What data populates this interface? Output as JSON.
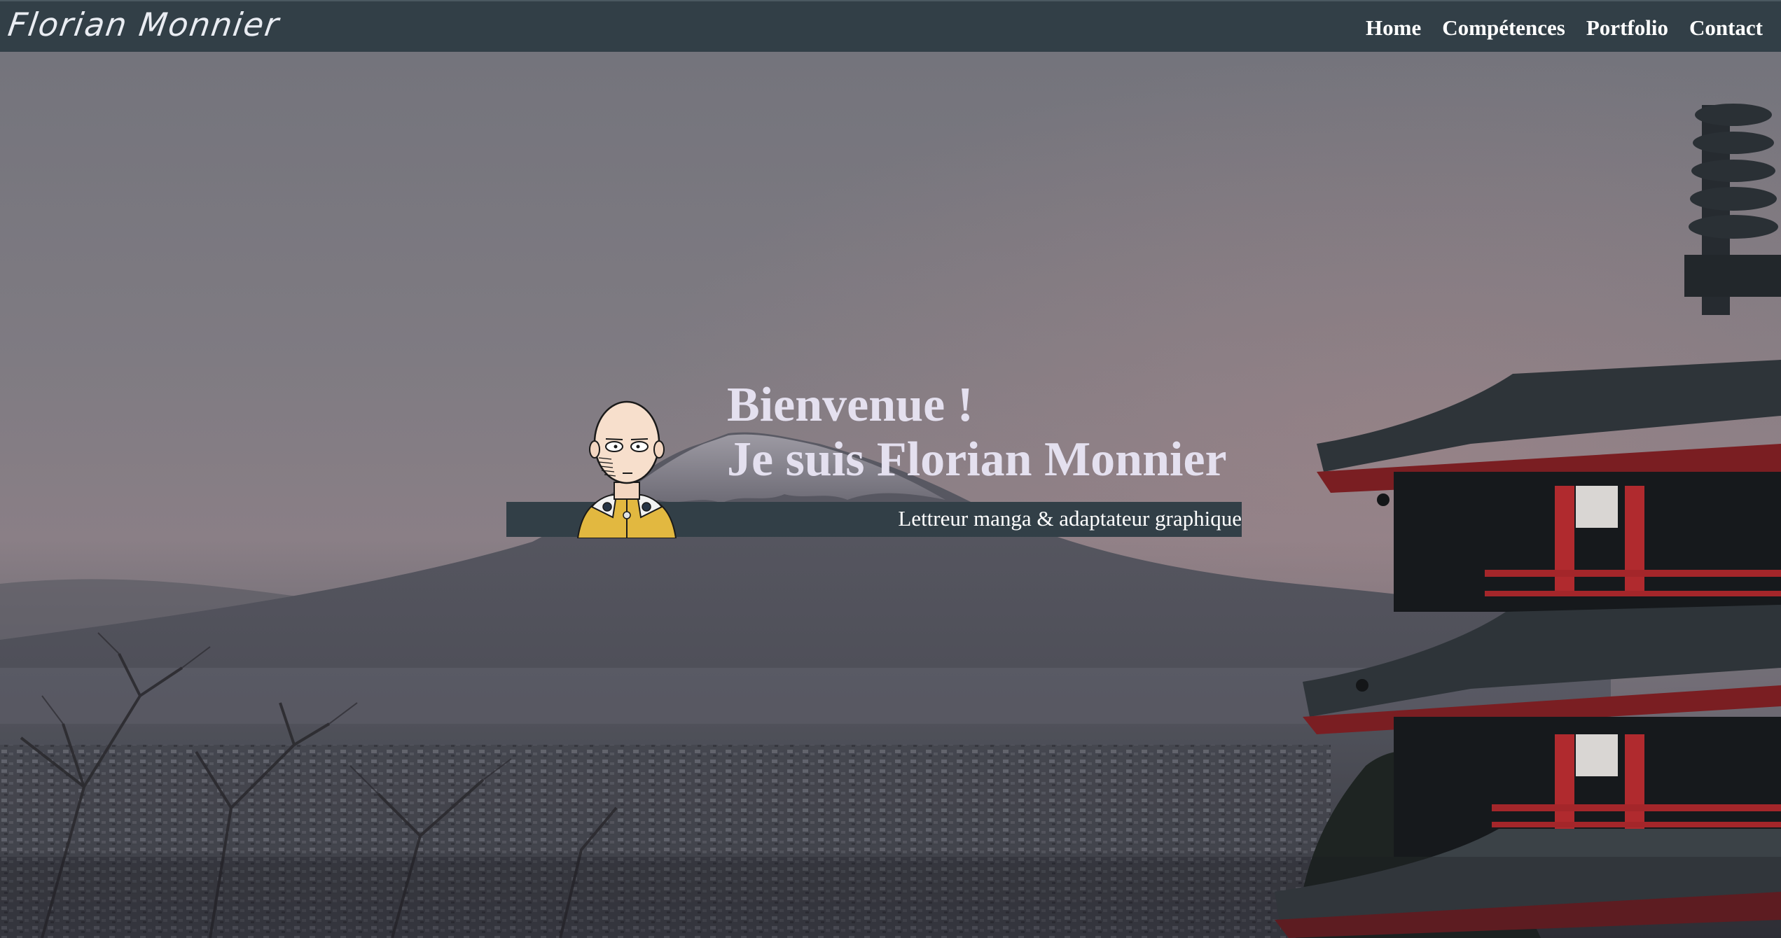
{
  "navbar": {
    "brand": "Florian Monnier",
    "links": [
      {
        "label": "Home"
      },
      {
        "label": "Compétences"
      },
      {
        "label": "Portfolio"
      },
      {
        "label": "Contact"
      }
    ]
  },
  "hero": {
    "greeting": "Bienvenue !",
    "intro": "Je suis Florian Monnier",
    "tagline": "Lettreur manga & adaptateur graphique"
  },
  "colors": {
    "navbar_bg": "#323f47",
    "tagline_bar_bg": "#323f47",
    "heading_text": "#e4e0ef",
    "nav_text": "#ffffff"
  },
  "icons": {
    "avatar": "bald-hero-avatar-icon"
  }
}
